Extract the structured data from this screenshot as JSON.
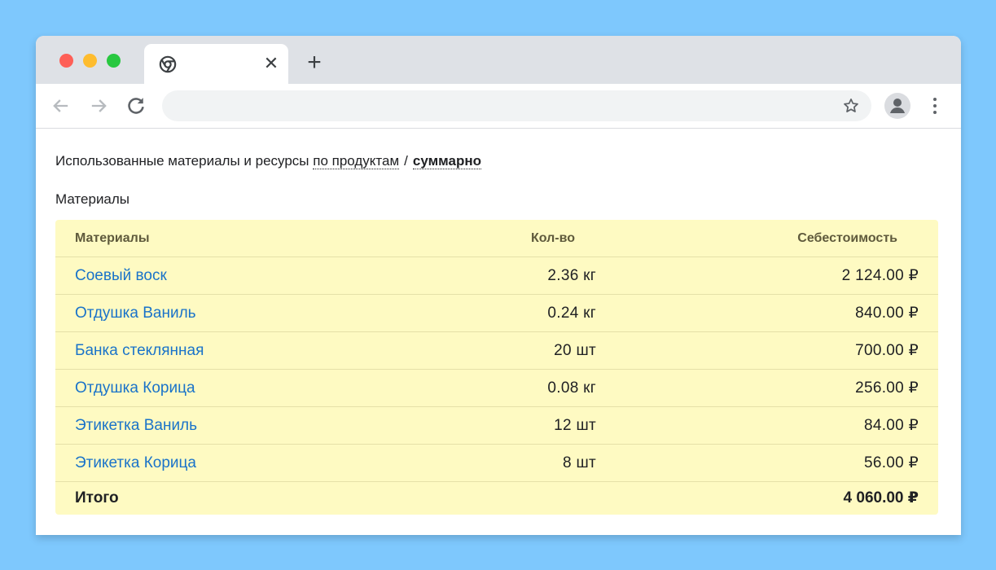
{
  "browser": {
    "tab": {
      "close_glyph": "✕"
    },
    "new_tab_glyph": "+",
    "icons": [
      "chrome-icon",
      "back-arrow-icon",
      "forward-arrow-icon",
      "reload-icon",
      "star-icon",
      "account-icon",
      "kebab-menu-icon"
    ]
  },
  "page": {
    "heading_text": "Использованные материалы и ресурсы",
    "view_by_products": "по продуктам",
    "separator": "/",
    "view_summary": "суммарно",
    "section_title": "Материалы"
  },
  "table": {
    "columns": {
      "name": "Материалы",
      "qty": "Кол-во",
      "cost": "Себестоимость"
    },
    "rows": [
      {
        "name": "Соевый воск",
        "qty": "2.36 кг",
        "cost": "2 124.00 ₽"
      },
      {
        "name": "Отдушка Ваниль",
        "qty": "0.24 кг",
        "cost": "840.00 ₽"
      },
      {
        "name": "Банка стеклянная",
        "qty": "20 шт",
        "cost": "700.00 ₽"
      },
      {
        "name": "Отдушка Корица",
        "qty": "0.08 кг",
        "cost": "256.00 ₽"
      },
      {
        "name": "Этикетка Ваниль",
        "qty": "12 шт",
        "cost": "84.00 ₽"
      },
      {
        "name": "Этикетка Корица",
        "qty": "8 шт",
        "cost": "56.00 ₽"
      }
    ],
    "total": {
      "label": "Итого",
      "cost": "4 060.00 ₽"
    }
  },
  "colors": {
    "background": "#7ec8fd",
    "table_bg": "#fefac2",
    "link": "#1a73c9"
  }
}
